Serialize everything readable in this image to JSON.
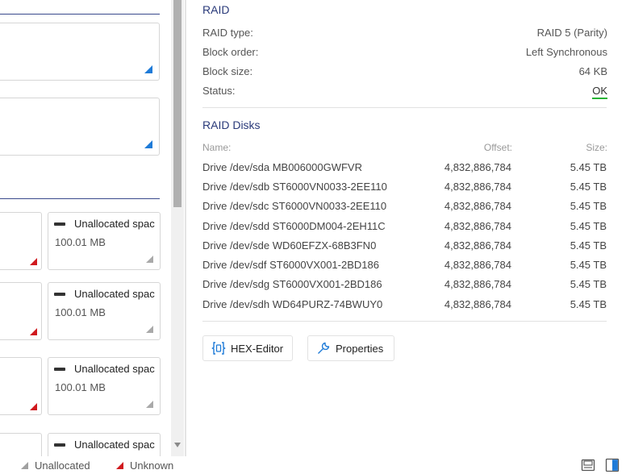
{
  "left": {
    "unallocated_cards": [
      {
        "title": "Unallocated spac",
        "size": "100.01 MB"
      },
      {
        "title": "Unallocated spac",
        "size": "100.01 MB"
      },
      {
        "title": "Unallocated spac",
        "size": "100.01 MB"
      },
      {
        "title": "Unallocated spac",
        "size": ""
      }
    ]
  },
  "raid": {
    "title": "RAID",
    "props": [
      {
        "label": "RAID type:",
        "value": "RAID 5 (Parity)"
      },
      {
        "label": "Block order:",
        "value": "Left Synchronous"
      },
      {
        "label": "Block size:",
        "value": "64 KB"
      },
      {
        "label": "Status:",
        "value": "OK"
      }
    ],
    "status_color": "#27b335"
  },
  "raid_disks": {
    "title": "RAID Disks",
    "headers": {
      "name": "Name:",
      "offset": "Offset:",
      "size": "Size:"
    },
    "rows": [
      {
        "name": "Drive /dev/sda MB006000GWFVR",
        "offset": "4,832,886,784",
        "size": "5.45 TB"
      },
      {
        "name": "Drive /dev/sdb ST6000VN0033-2EE110",
        "offset": "4,832,886,784",
        "size": "5.45 TB"
      },
      {
        "name": "Drive /dev/sdc ST6000VN0033-2EE110",
        "offset": "4,832,886,784",
        "size": "5.45 TB"
      },
      {
        "name": "Drive /dev/sdd ST6000DM004-2EH11C",
        "offset": "4,832,886,784",
        "size": "5.45 TB"
      },
      {
        "name": "Drive /dev/sde WD60EFZX-68B3FN0",
        "offset": "4,832,886,784",
        "size": "5.45 TB"
      },
      {
        "name": "Drive /dev/sdf ST6000VX001-2BD186",
        "offset": "4,832,886,784",
        "size": "5.45 TB"
      },
      {
        "name": "Drive /dev/sdg ST6000VX001-2BD186",
        "offset": "4,832,886,784",
        "size": "5.45 TB"
      },
      {
        "name": "Drive /dev/sdh WD64PURZ-74BWUY0",
        "offset": "4,832,886,784",
        "size": "5.45 TB"
      }
    ]
  },
  "actions": {
    "hex_editor": "HEX-Editor",
    "properties": "Properties"
  },
  "statusbar": {
    "legend_unallocated": "Unallocated",
    "legend_unknown": "Unknown"
  },
  "icons": {
    "hex_editor": "hex-editor-icon",
    "properties": "wrench-icon",
    "save": "save-icon",
    "panel_toggle": "panel-toggle-icon"
  },
  "colors": {
    "accent_blue": "#1e7bd8",
    "unknown_red": "#d0191e",
    "section_title": "#2a3a7a"
  }
}
